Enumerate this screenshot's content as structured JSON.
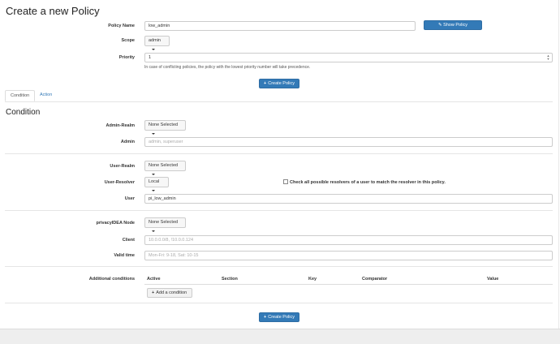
{
  "header": {
    "title": "Create a new Policy"
  },
  "form": {
    "policy_name_label": "Policy Name",
    "policy_name_value": "low_admin",
    "show_templates_label": "Show Policy templates",
    "scope_label": "Scope",
    "scope_value": "admin",
    "priority_label": "Priority",
    "priority_value": "1",
    "priority_help": "In case of conflicting policies, the policy with the lowest priority number will take precedence.",
    "create_button_label": "Create Policy"
  },
  "tabs": [
    {
      "label": "Condition"
    },
    {
      "label": "Action"
    }
  ],
  "condition": {
    "heading": "Condition",
    "admin_realm_label": "Admin-Realm",
    "admin_realm_value": "None Selected",
    "admin_label": "Admin",
    "admin_placeholder": "admin, superuser",
    "user_realm_label": "User-Realm",
    "user_realm_value": "None Selected",
    "user_resolver_label": "User-Resolver",
    "user_resolver_value": "Local",
    "check_resolvers_text": "Check all possible resolvers of a user to match the resolver in this policy.",
    "user_label": "User",
    "user_value": "pi_low_admin",
    "node_label": "privacyIDEA Node",
    "node_value": "None Selected",
    "client_label": "Client",
    "client_placeholder": "10.0.0.0/8, !10.0.0.124",
    "valid_time_label": "Valid time",
    "valid_time_placeholder": "Mon-Fri: 9-18, Sat: 10-15",
    "additional_label": "Additional conditions",
    "columns": [
      "Active",
      "Section",
      "Key",
      "Comparator",
      "Value"
    ],
    "add_condition_label": "Add a condition"
  },
  "bottom": {
    "create_button_label": "Create Policy"
  }
}
